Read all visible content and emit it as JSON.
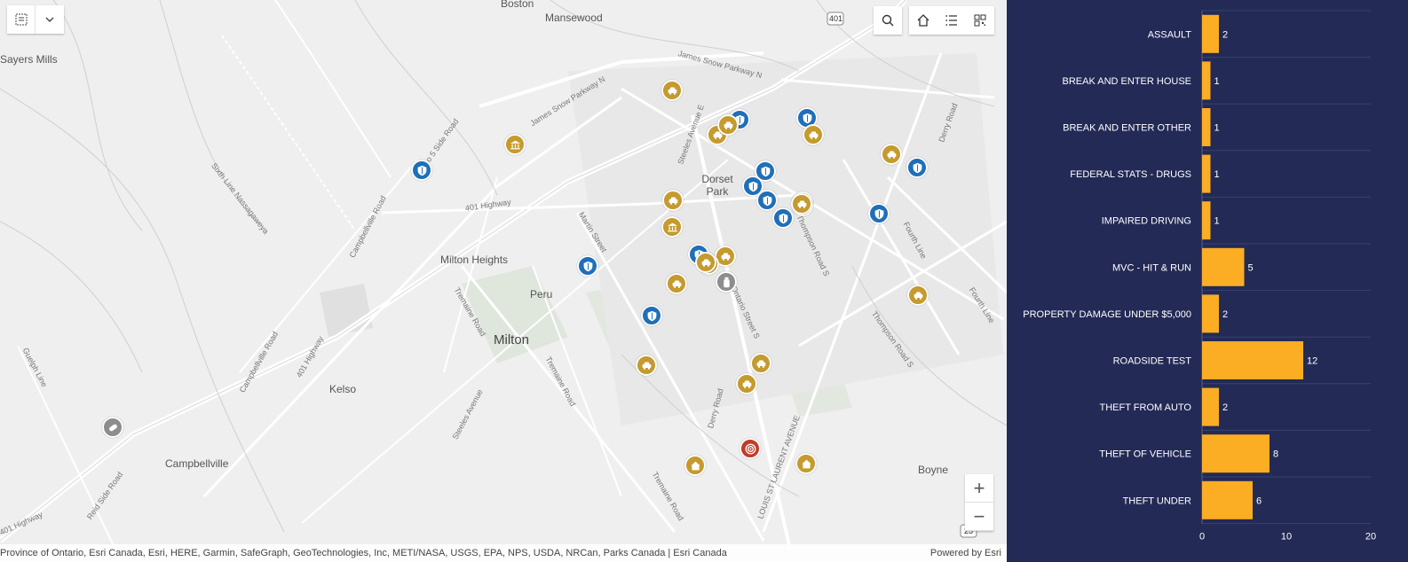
{
  "map": {
    "places": [
      {
        "name": "Boston"
      },
      {
        "name": "Mansewood"
      },
      {
        "name": "Sayers Mills"
      },
      {
        "name": "Dorset Park"
      },
      {
        "name": "Milton Heights"
      },
      {
        "name": "Peru"
      },
      {
        "name": "Milton"
      },
      {
        "name": "Kelso"
      },
      {
        "name": "Campbellville"
      },
      {
        "name": "Boyne"
      }
    ],
    "roads": [
      "James Snow Parkway N",
      "James Snow Parkway N",
      "No 5 Side Road",
      "Sixth Line Nassagaweya",
      "401 Highway",
      "Campbellville Road",
      "Martin Street",
      "Tremaine Road",
      "Campbellville Road",
      "401 Highway",
      "Guelph Line",
      "Steeles Avenue",
      "Tremaine Road",
      "Derry Road",
      "Thompson Road S",
      "Fourth Line",
      "Derry Road",
      "LOUIS ST LAURENT AVENUE",
      "Tremaine Road",
      "Reid Side Road",
      "401 Highway",
      "Steeles Avenue E",
      "Fourth Line",
      "Thompson Road S",
      "Ontario Street S"
    ],
    "highway_shields": [
      "401",
      "25"
    ],
    "attribution": "Province of Ontario, Esri Canada, Esri, HERE, Garmin, SafeGraph, GeoTechnologies, Inc, METI/NASA, USGS, EPA, NPS, USDA, NRCan, Parks Canada | Esri Canada",
    "powered_by": "Powered by Esri",
    "zoom_in": "+",
    "zoom_out": "−",
    "markers": [
      {
        "type": "police",
        "icon": "shield-icon"
      },
      {
        "type": "police",
        "icon": "shield-icon"
      },
      {
        "type": "police",
        "icon": "shield-icon"
      },
      {
        "type": "police",
        "icon": "shield-icon"
      },
      {
        "type": "police",
        "icon": "shield-icon"
      },
      {
        "type": "police",
        "icon": "shield-icon"
      },
      {
        "type": "police",
        "icon": "shield-icon"
      },
      {
        "type": "police",
        "icon": "shield-icon"
      },
      {
        "type": "police",
        "icon": "shield-icon"
      },
      {
        "type": "police",
        "icon": "shield-icon"
      },
      {
        "type": "police",
        "icon": "shield-icon"
      },
      {
        "type": "police",
        "icon": "shield-icon"
      },
      {
        "type": "vehicle",
        "icon": "car-icon"
      },
      {
        "type": "vehicle",
        "icon": "car-icon"
      },
      {
        "type": "vehicle",
        "icon": "car-icon"
      },
      {
        "type": "vehicle",
        "icon": "car-icon"
      },
      {
        "type": "vehicle",
        "icon": "car-icon"
      },
      {
        "type": "vehicle",
        "icon": "car-icon"
      },
      {
        "type": "vehicle",
        "icon": "car-icon"
      },
      {
        "type": "vehicle",
        "icon": "car-icon"
      },
      {
        "type": "vehicle",
        "icon": "car-icon"
      },
      {
        "type": "vehicle",
        "icon": "car-icon"
      },
      {
        "type": "vehicle",
        "icon": "car-icon"
      },
      {
        "type": "vehicle",
        "icon": "car-icon"
      },
      {
        "type": "vehicle",
        "icon": "car-icon"
      },
      {
        "type": "vehicle",
        "icon": "car-icon"
      },
      {
        "type": "vehicle",
        "icon": "car-icon"
      },
      {
        "type": "vehicle",
        "icon": "car-icon"
      },
      {
        "type": "vehicle",
        "icon": "car-icon"
      },
      {
        "type": "bank",
        "icon": "bank-icon"
      },
      {
        "type": "bank",
        "icon": "bank-icon"
      },
      {
        "type": "house",
        "icon": "house-icon"
      },
      {
        "type": "house",
        "icon": "house-icon"
      },
      {
        "type": "drugs",
        "icon": "bottle-icon"
      },
      {
        "type": "drugs",
        "icon": "pill-icon"
      },
      {
        "type": "target",
        "icon": "target-icon"
      }
    ]
  },
  "toolbar": {
    "legend_toggle_icon": "map-layers-icon",
    "dropdown_icon": "chevron-down-icon",
    "search_icon": "search-icon",
    "home_icon": "home-icon",
    "list_icon": "list-icon",
    "qr_icon": "qr-icon"
  },
  "colors": {
    "panel_bg": "#232a56",
    "bar": "#fbad24",
    "police": "#1f6fb8",
    "vehicle": "#c59a2e",
    "drugs": "#8d8d8d",
    "target": "#c13b2b"
  },
  "chart_data": {
    "type": "bar",
    "orientation": "horizontal",
    "categories": [
      "ASSAULT",
      "BREAK AND ENTER HOUSE",
      "BREAK AND ENTER OTHER",
      "FEDERAL STATS - DRUGS",
      "IMPAIRED DRIVING",
      "MVC - HIT & RUN",
      "PROPERTY DAMAGE UNDER $5,000",
      "ROADSIDE TEST",
      "THEFT FROM AUTO",
      "THEFT OF VEHICLE",
      "THEFT UNDER"
    ],
    "values": [
      2,
      1,
      1,
      1,
      1,
      5,
      2,
      12,
      2,
      8,
      6
    ],
    "xlim": [
      0,
      20
    ],
    "xticks": [
      "0",
      "10",
      "20"
    ],
    "title": "",
    "xlabel": "",
    "ylabel": ""
  }
}
